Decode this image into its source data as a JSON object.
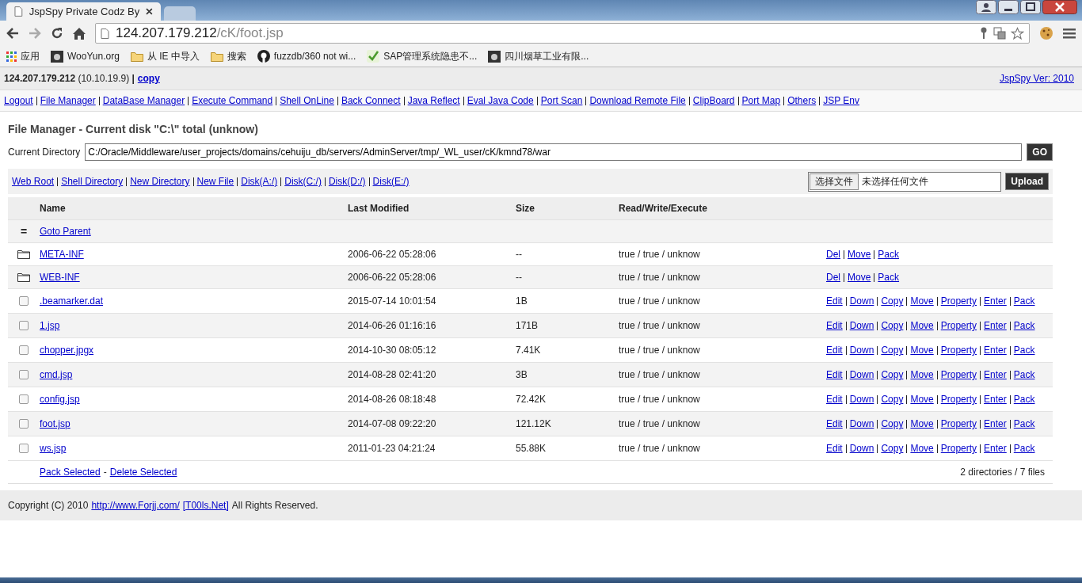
{
  "browser": {
    "tabs": [
      {
        "title": "JspSpy Private Codz By",
        "selected": true
      },
      {
        "selected": false
      }
    ],
    "url": {
      "host": "124.207.179.212",
      "path": "/cK/foot.jsp"
    },
    "bookmarks": [
      {
        "label": "应用",
        "kind": "apps"
      },
      {
        "label": "WooYun.org",
        "kind": "site"
      },
      {
        "label": "从 IE 中导入",
        "kind": "folder"
      },
      {
        "label": "搜索",
        "kind": "folder"
      },
      {
        "label": "fuzzdb/360 not wi...",
        "kind": "github"
      },
      {
        "label": "SAP管理系统隐患不...",
        "kind": "check"
      },
      {
        "label": "四川烟草工业有限...",
        "kind": "site"
      }
    ]
  },
  "server": {
    "ip": "124.207.179.212",
    "internal": "(10.10.19.9)",
    "separator": "|",
    "copy_link": "copy",
    "version_link": "JspSpy Ver: 2010"
  },
  "nav_links": [
    "Logout",
    "File Manager",
    "DataBase Manager",
    "Execute Command",
    "Shell OnLine",
    "Back Connect",
    "Java Reflect",
    "Eval Java Code",
    "Port Scan",
    "Download Remote File",
    "ClipBoard",
    "Port Map",
    "Others",
    "JSP Env"
  ],
  "heading": "File Manager - Current disk \"C:\\\" total (unknow)",
  "directory": {
    "label": "Current Directory",
    "value": "C:/Oracle/Middleware/user_projects/domains/cehuiju_db/servers/AdminServer/tmp/_WL_user/cK/kmnd78/war",
    "button": "GO"
  },
  "tool_links": [
    "Web Root",
    "Shell Directory",
    "New Directory",
    "New File",
    "Disk(A:/)",
    "Disk(C:/)",
    "Disk(D:/)",
    "Disk(E:/)"
  ],
  "upload": {
    "choose_button": "选择文件",
    "status": "未选择任何文件",
    "submit": "Upload"
  },
  "table": {
    "columns": [
      "Name",
      "Last Modified",
      "Size",
      "Read/Write/Execute"
    ],
    "rows": [
      {
        "kind": "parent",
        "marker": "=",
        "name": "Goto Parent"
      },
      {
        "kind": "dir",
        "name": "META-INF",
        "modified": "2006-06-22 05:28:06",
        "size": "--",
        "rwx": "true / true / unknow",
        "actions": [
          "Del",
          "Move",
          "Pack"
        ]
      },
      {
        "kind": "dir",
        "name": "WEB-INF",
        "modified": "2006-06-22 05:28:06",
        "size": "--",
        "rwx": "true / true / unknow",
        "actions": [
          "Del",
          "Move",
          "Pack"
        ]
      },
      {
        "kind": "file",
        "checked": false,
        "name": ".beamarker.dat",
        "modified": "2015-07-14 10:01:54",
        "size": "1B",
        "rwx": "true / true / unknow",
        "actions": [
          "Edit",
          "Down",
          "Copy",
          "Move",
          "Property",
          "Enter",
          "Pack"
        ]
      },
      {
        "kind": "file",
        "checked": false,
        "name": "1.jsp",
        "modified": "2014-06-26 01:16:16",
        "size": "171B",
        "rwx": "true / true / unknow",
        "actions": [
          "Edit",
          "Down",
          "Copy",
          "Move",
          "Property",
          "Enter",
          "Pack"
        ]
      },
      {
        "kind": "file",
        "checked": false,
        "name": "chopper.jpgx",
        "modified": "2014-10-30 08:05:12",
        "size": "7.41K",
        "rwx": "true / true / unknow",
        "actions": [
          "Edit",
          "Down",
          "Copy",
          "Move",
          "Property",
          "Enter",
          "Pack"
        ]
      },
      {
        "kind": "file",
        "checked": false,
        "name": "cmd.jsp",
        "modified": "2014-08-28 02:41:20",
        "size": "3B",
        "rwx": "true / true / unknow",
        "actions": [
          "Edit",
          "Down",
          "Copy",
          "Move",
          "Property",
          "Enter",
          "Pack"
        ]
      },
      {
        "kind": "file",
        "checked": false,
        "name": "config.jsp",
        "modified": "2014-08-26 08:18:48",
        "size": "72.42K",
        "rwx": "true / true / unknow",
        "actions": [
          "Edit",
          "Down",
          "Copy",
          "Move",
          "Property",
          "Enter",
          "Pack"
        ]
      },
      {
        "kind": "file",
        "checked": false,
        "name": "foot.jsp",
        "modified": "2014-07-08 09:22:20",
        "size": "121.12K",
        "rwx": "true / true / unknow",
        "actions": [
          "Edit",
          "Down",
          "Copy",
          "Move",
          "Property",
          "Enter",
          "Pack"
        ]
      },
      {
        "kind": "file",
        "checked": false,
        "name": "ws.jsp",
        "modified": "2011-01-23 04:21:24",
        "size": "55.88K",
        "rwx": "true / true / unknow",
        "actions": [
          "Edit",
          "Down",
          "Copy",
          "Move",
          "Property",
          "Enter",
          "Pack"
        ]
      }
    ],
    "footer": {
      "pack_selected": "Pack Selected",
      "dash": "-",
      "delete_selected": "Delete Selected",
      "summary": "2 directories / 7 files"
    }
  },
  "copyright": {
    "text": "Copyright (C) 2010",
    "link1": "http://www.Forjj.com/",
    "link2": "[T00ls.Net]",
    "tail": "All Rights Reserved."
  }
}
